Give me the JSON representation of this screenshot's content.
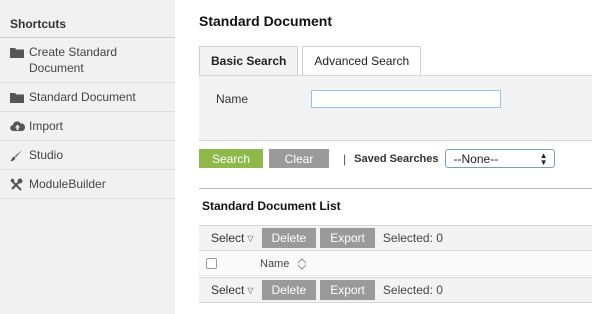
{
  "sidebar": {
    "title": "Shortcuts",
    "items": [
      {
        "label": "Create Standard Document",
        "icon": "folder-icon"
      },
      {
        "label": "Standard Document",
        "icon": "folder-icon"
      },
      {
        "label": "Import",
        "icon": "cloud-upload-icon"
      },
      {
        "label": "Studio",
        "icon": "brush-icon"
      },
      {
        "label": "ModuleBuilder",
        "icon": "tools-icon"
      }
    ]
  },
  "main": {
    "title": "Standard Document",
    "tabs": [
      {
        "label": "Basic Search",
        "active": true
      },
      {
        "label": "Advanced Search",
        "active": false
      }
    ],
    "search": {
      "name_label": "Name",
      "name_value": "",
      "search_button": "Search",
      "clear_button": "Clear",
      "separator": "|",
      "saved_searches_label": "Saved Searches",
      "saved_searches_value": "--None--"
    },
    "list": {
      "title": "Standard Document List",
      "select_label": "Select",
      "delete_button": "Delete",
      "export_button": "Export",
      "selected_text": "Selected: 0",
      "columns": [
        "Name"
      ],
      "rows": []
    }
  },
  "colors": {
    "sidebar_bg": "#f1f1f1",
    "search_button": "#8fb84a",
    "gray_button": "#9a9a9a",
    "input_border": "#9cc3dd"
  }
}
